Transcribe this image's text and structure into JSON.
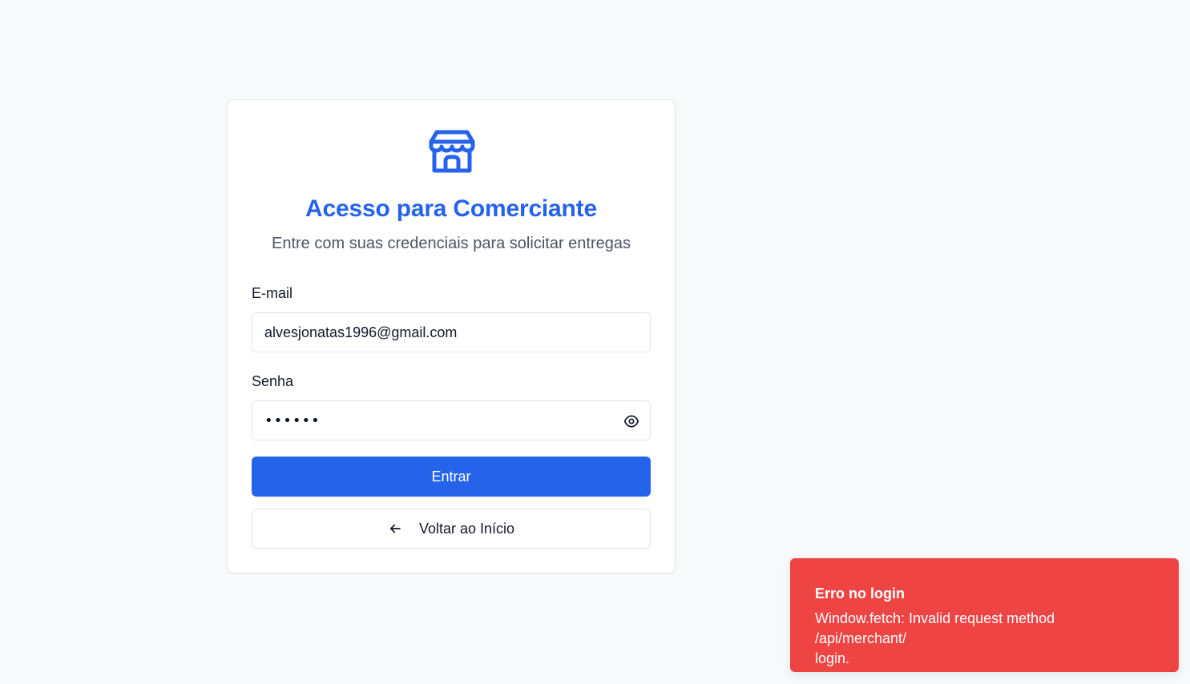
{
  "login_card": {
    "icon": "store-icon",
    "title": "Acesso para Comerciante",
    "subtitle": "Entre com suas credenciais para solicitar entregas",
    "email": {
      "label": "E-mail",
      "value": "alvesjonatas1996@gmail.com"
    },
    "password": {
      "label": "Senha",
      "masked_value": "••••••",
      "toggle_icon": "eye-icon"
    },
    "submit_label": "Entrar",
    "back": {
      "label": "Voltar ao Início",
      "icon": "arrow-left-icon"
    }
  },
  "toast": {
    "title": "Erro no login",
    "message": "Window.fetch: Invalid request method /api/merchant/\nlogin."
  },
  "colors": {
    "primary": "#2563eb",
    "error": "#ef4444",
    "background": "#f8f9fb"
  }
}
